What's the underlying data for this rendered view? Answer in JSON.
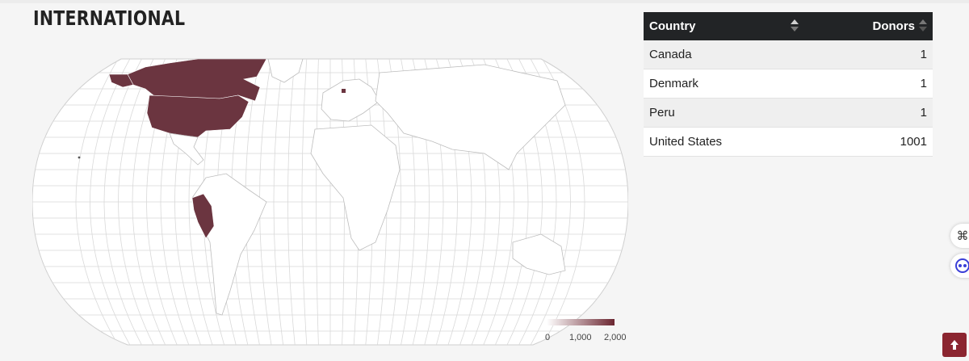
{
  "section": {
    "title": "INTERNATIONAL"
  },
  "map": {
    "fill_color": "#6b3540",
    "highlighted_countries": [
      "Canada",
      "United States",
      "Denmark",
      "Peru"
    ],
    "legend": {
      "min_label": "0",
      "mid_label": "1,000",
      "max_label": "2,000",
      "color_low": "#ffffff",
      "color_high": "#6b2631"
    }
  },
  "table": {
    "headers": {
      "country": "Country",
      "donors": "Donors"
    },
    "rows": [
      {
        "country": "Canada",
        "donors": "1"
      },
      {
        "country": "Denmark",
        "donors": "1"
      },
      {
        "country": "Peru",
        "donors": "1"
      },
      {
        "country": "United States",
        "donors": "1001"
      }
    ]
  },
  "side_buttons": [
    {
      "icon": "command-icon",
      "glyph": "⌘"
    },
    {
      "icon": "assistant-face-icon",
      "glyph": ""
    }
  ],
  "back_to_top": {
    "icon": "arrow-up-icon"
  }
}
